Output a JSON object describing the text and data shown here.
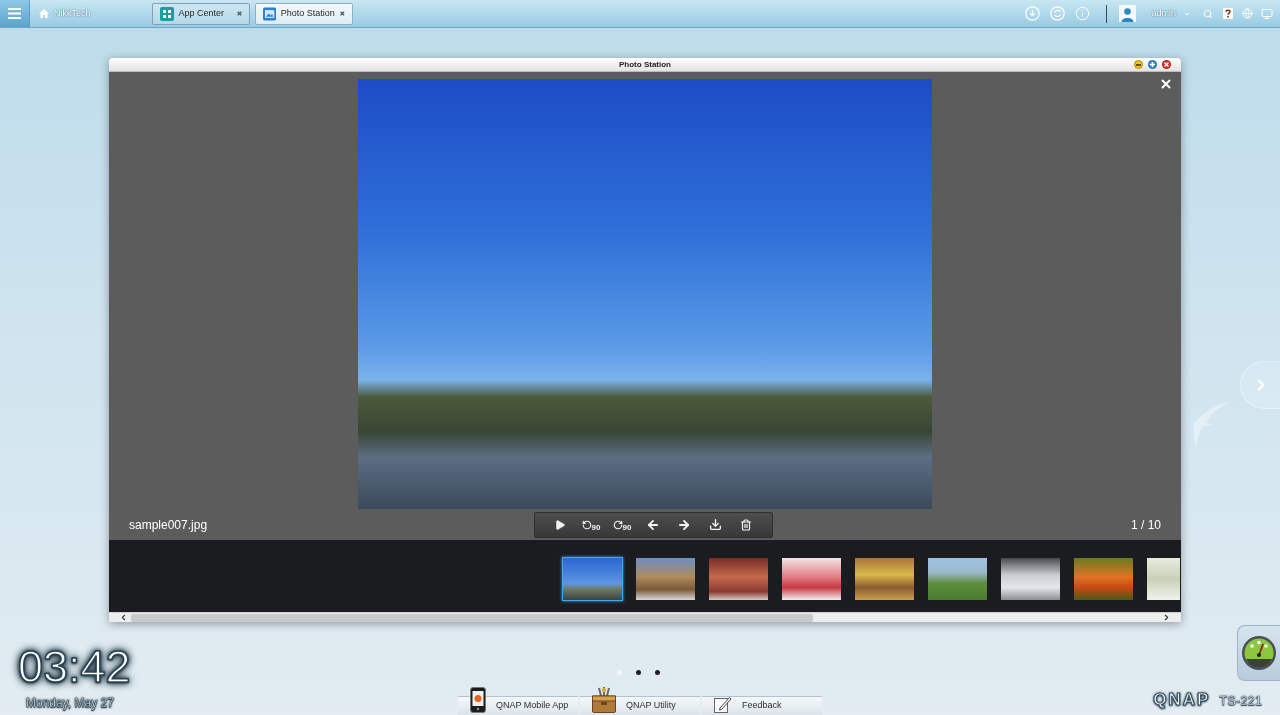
{
  "taskbar": {
    "home": {
      "label": "NikkTech"
    },
    "tabs": [
      {
        "kind": "app_center",
        "label": "App Center",
        "selected": false
      },
      {
        "kind": "photo",
        "label": "Photo Station",
        "selected": true
      }
    ],
    "user": {
      "name": "admin"
    }
  },
  "window": {
    "title": "Photo Station",
    "viewer": {
      "filename": "sample007.jpg",
      "counter": "1 / 10",
      "toolbar": [
        {
          "kind": "play"
        },
        {
          "kind": "rotate_left",
          "label": "90"
        },
        {
          "kind": "rotate_right",
          "label": "90"
        },
        {
          "kind": "previous"
        },
        {
          "kind": "next"
        },
        {
          "kind": "download"
        },
        {
          "kind": "delete"
        }
      ]
    },
    "thumbnails": [
      {
        "selected": true
      },
      {
        "selected": false
      },
      {
        "selected": false
      },
      {
        "selected": false
      },
      {
        "selected": false
      },
      {
        "selected": false
      },
      {
        "selected": false
      },
      {
        "selected": false
      },
      {
        "selected": false
      }
    ]
  },
  "desktop": {
    "clock": {
      "time": "03:42",
      "date": "Monday, May 27"
    },
    "page_dots": [
      {
        "selected": true
      },
      {
        "selected": false
      },
      {
        "selected": false
      }
    ],
    "dock": [
      {
        "kind": "mobile",
        "label": "QNAP Mobile App"
      },
      {
        "kind": "utility",
        "label": "QNAP Utility"
      },
      {
        "kind": "feedback",
        "label": "Feedback"
      }
    ],
    "brand": {
      "logo": "QNAP",
      "model": "TS-221"
    }
  }
}
